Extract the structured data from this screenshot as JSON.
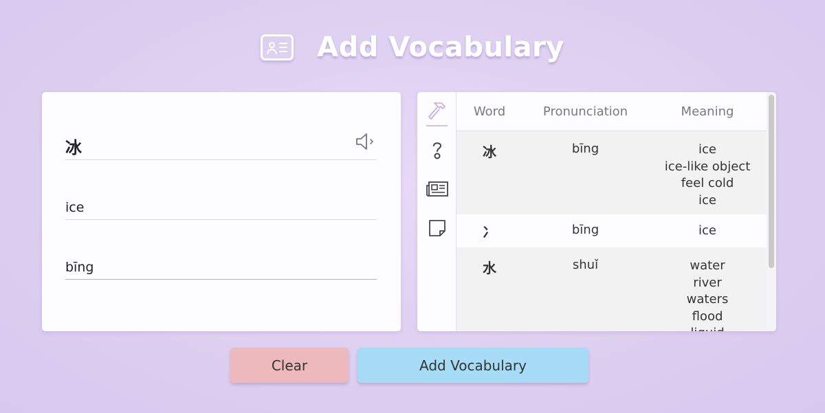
{
  "header": {
    "title": "Add Vocabulary",
    "icon": "contact-card-icon"
  },
  "form": {
    "word_value": "冰",
    "meaning_value": "ice",
    "pronunciation_value": "bīng",
    "speaker_icon": "speaker-icon"
  },
  "side_tabs": [
    {
      "icon": "hammer-icon",
      "active": true
    },
    {
      "icon": "question-icon",
      "active": false
    },
    {
      "icon": "newspaper-icon",
      "active": false
    },
    {
      "icon": "sticky-note-icon",
      "active": false
    }
  ],
  "table": {
    "headers": {
      "word": "Word",
      "pronunciation": "Pronunciation",
      "meaning": "Meaning"
    },
    "rows": [
      {
        "word": "冰",
        "pronunciation": "bīng",
        "meanings": [
          "ice",
          "ice-like object",
          "feel cold",
          "ice"
        ]
      },
      {
        "word": "冫",
        "pronunciation": "bīng",
        "meanings": [
          "ice"
        ]
      },
      {
        "word": "水",
        "pronunciation": "shuǐ",
        "meanings": [
          "water",
          "river",
          "waters",
          "flood",
          "liquid"
        ]
      }
    ]
  },
  "buttons": {
    "clear": "Clear",
    "add": "Add Vocabulary"
  },
  "colors": {
    "background": "#ddd0f0",
    "clear_button": "#edb9bc",
    "add_button": "#a6dcf6",
    "active_underline": "#b8a8de"
  }
}
